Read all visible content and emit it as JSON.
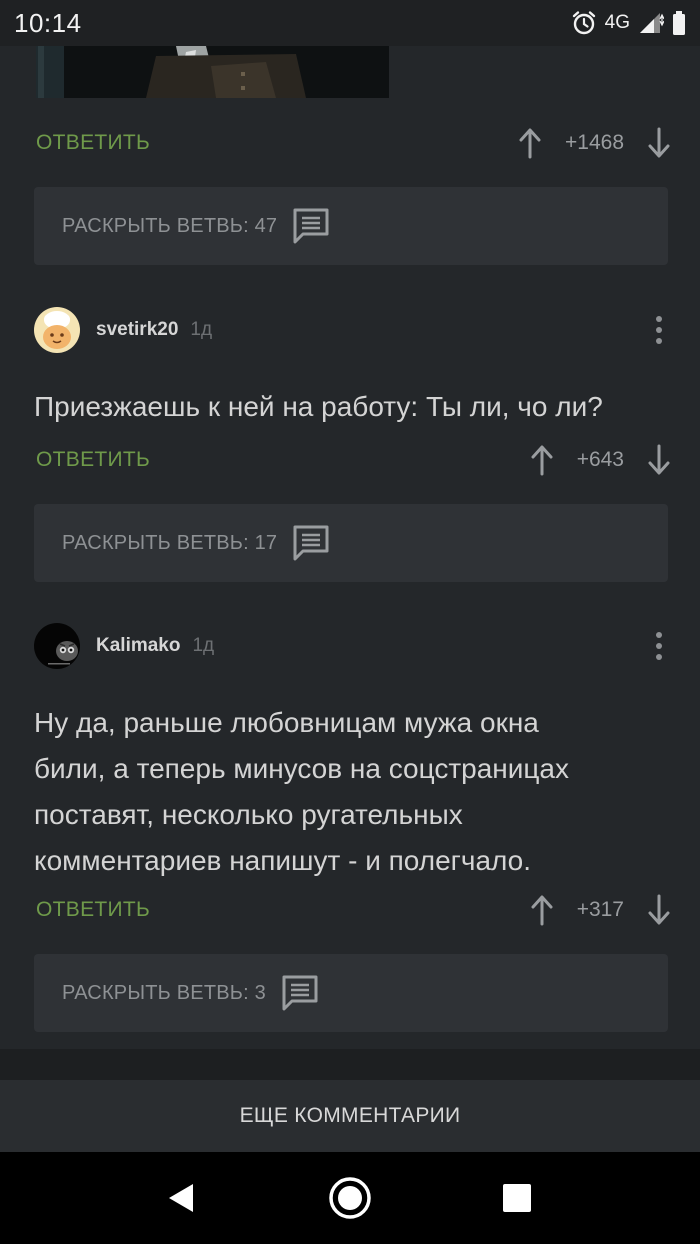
{
  "status_bar": {
    "time": "10:14",
    "network": "4G"
  },
  "reply_label": "ОТВЕТИТЬ",
  "rows": [
    {
      "score": "+1468"
    },
    {
      "score": "+643"
    },
    {
      "score": "+317"
    }
  ],
  "branches": [
    {
      "label": "РАСКРЫТЬ ВЕТВЬ: 47"
    },
    {
      "label": "РАСКРЫТЬ ВЕТВЬ: 17"
    },
    {
      "label": "РАСКРЫТЬ ВЕТВЬ: 3"
    }
  ],
  "comments": [
    {
      "author": "svetirk20",
      "time": "1д",
      "text_lines": [
        "Приезжаешь к ней на работу: Ты ли, чо ли?"
      ]
    },
    {
      "author": "Kalimako",
      "time": "1д",
      "text_lines": [
        "Ну да, раньше любовницам мужа окна",
        "били, а теперь минусов на соцстраницах",
        "поставят, несколько ругательных",
        "комментариев напишут - и полегчало."
      ]
    }
  ],
  "more_comments_label": "ЕЩЕ КОММЕНТАРИИ",
  "colors": {
    "background": "#24272a",
    "reply_green": "#6f9a4a",
    "branch_bg": "#2f3236"
  }
}
